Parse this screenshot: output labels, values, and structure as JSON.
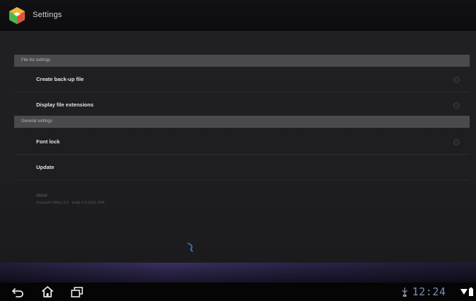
{
  "action_bar": {
    "title": "Settings",
    "icon": "app-logo-icon"
  },
  "sections": [
    {
      "header": "File list settings",
      "items": [
        {
          "label": "Create back-up file",
          "control": "checkbox",
          "checked": false
        },
        {
          "label": "Display file extensions",
          "control": "checkbox",
          "checked": false
        }
      ]
    },
    {
      "header": "General settings",
      "items": [
        {
          "label": "Font lock",
          "control": "checkbox",
          "checked": false
        },
        {
          "label": "Update",
          "control": "none"
        }
      ]
    }
  ],
  "about": {
    "title": "About",
    "version": "Polaris® Office 3.0 · build 3.0.3031 P06"
  },
  "system_bar": {
    "clock": "12:24",
    "nav_icons": [
      "back-icon",
      "home-icon",
      "recent-apps-icon"
    ],
    "status_icons": [
      "usb-icon",
      "wifi-icon",
      "battery-icon"
    ]
  },
  "colors": {
    "background": "#1e1e21",
    "section_header": "#4a4a4e",
    "clock": "#7b8dbb",
    "accent_glow": "#3a2f5e"
  }
}
